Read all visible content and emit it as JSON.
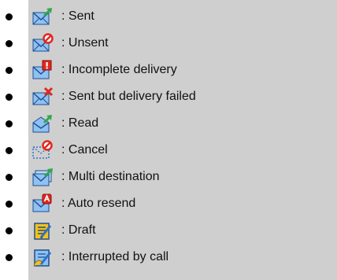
{
  "colors": {
    "panel": "#cfcfcf",
    "envelope_front": "#2d71c8",
    "envelope_back": "#8fc1f2",
    "arrow_green": "#31a94a",
    "alert_red": "#e2271d",
    "draft_yellow": "#f2c21c"
  },
  "items": [
    {
      "label": ": Sent",
      "icon": "mail-sent-icon"
    },
    {
      "label": ": Unsent",
      "icon": "mail-unsent-icon"
    },
    {
      "label": ": Incomplete delivery",
      "icon": "mail-incomplete-icon"
    },
    {
      "label": ": Sent but delivery failed",
      "icon": "mail-failed-icon"
    },
    {
      "label": ": Read",
      "icon": "mail-read-icon"
    },
    {
      "label": ": Cancel",
      "icon": "mail-cancel-icon"
    },
    {
      "label": ": Multi destination",
      "icon": "mail-multi-icon"
    },
    {
      "label": ": Auto resend",
      "icon": "mail-resend-icon"
    },
    {
      "label": ": Draft",
      "icon": "draft-icon"
    },
    {
      "label": ": Interrupted by call",
      "icon": "interrupted-call-icon"
    }
  ]
}
